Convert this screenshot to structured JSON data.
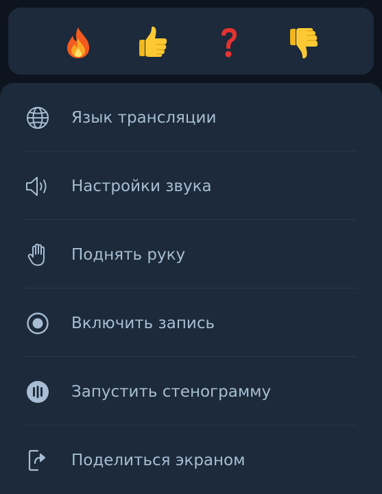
{
  "reactions": [
    {
      "name": "fire-icon"
    },
    {
      "name": "thumbs-up-icon"
    },
    {
      "name": "question-mark-icon"
    },
    {
      "name": "thumbs-down-icon"
    }
  ],
  "menu": {
    "items": [
      {
        "label": "Язык трансляции",
        "icon": "globe-icon"
      },
      {
        "label": "Настройки звука",
        "icon": "speaker-icon"
      },
      {
        "label": "Поднять руку",
        "icon": "hand-icon"
      },
      {
        "label": "Включить запись",
        "icon": "record-icon"
      },
      {
        "label": "Запустить стенограмму",
        "icon": "transcript-icon"
      },
      {
        "label": "Поделиться экраном",
        "icon": "share-screen-icon"
      }
    ]
  },
  "colors": {
    "background": "#0d141d",
    "panel": "#1c2a3b",
    "text": "#a8bdd3",
    "divider": "#2a394b"
  }
}
